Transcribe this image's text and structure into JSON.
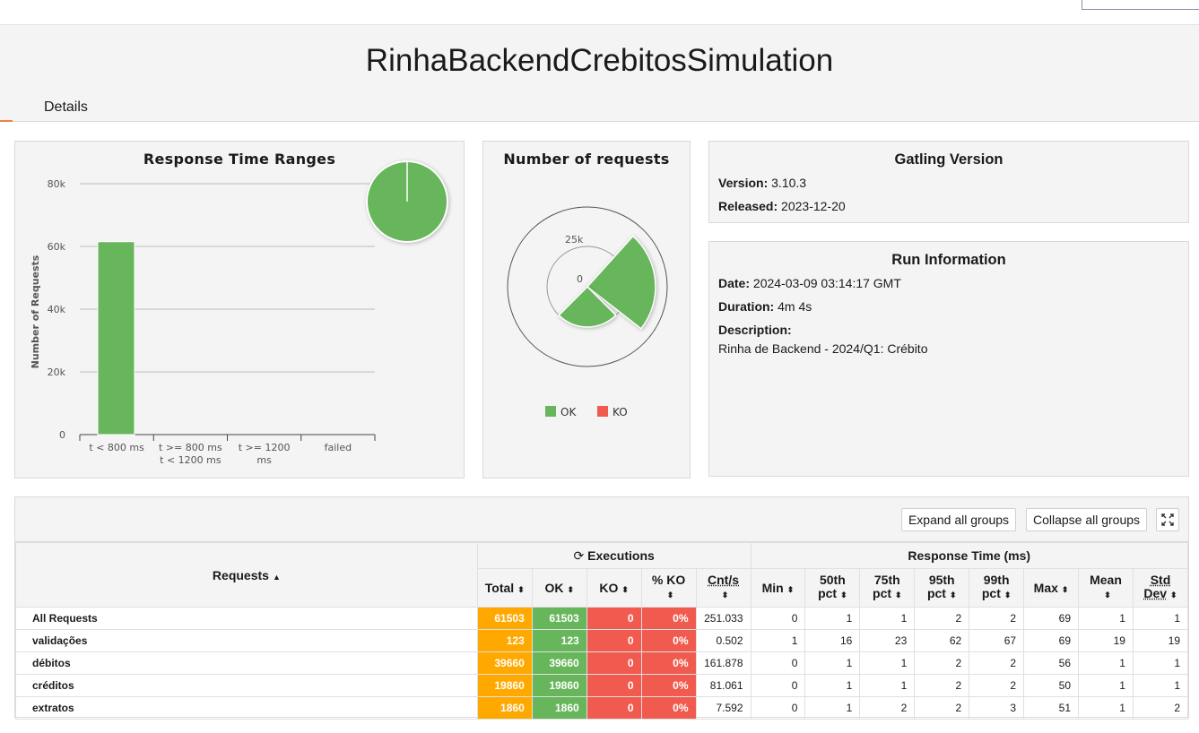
{
  "page": {
    "title": "RinhaBackendCrebitosSimulation",
    "tab_details": "Details"
  },
  "panels": {
    "response_time_ranges": {
      "title": "Response Time Ranges",
      "ylabel": "Number of Requests"
    },
    "number_of_requests": {
      "title": "Number of requests",
      "legend_ok": "OK",
      "legend_ko": "KO"
    },
    "gatling_version": {
      "title": "Gatling Version",
      "version_label": "Version:",
      "version_value": "3.10.3",
      "released_label": "Released:",
      "released_value": "2023-12-20"
    },
    "run_information": {
      "title": "Run Information",
      "date_label": "Date:",
      "date_value": "2024-03-09 03:14:17 GMT",
      "duration_label": "Duration:",
      "duration_value": "4m 4s",
      "description_label": "Description:",
      "description_value": "Rinha de Backend - 2024/Q1: Crébito"
    }
  },
  "colors": {
    "ok": "#68b65c",
    "ko": "#f15b4f",
    "total": "#ffa900",
    "accent": "#f0823c"
  },
  "chart_data": [
    {
      "type": "bar",
      "title": "Response Time Ranges",
      "ylabel": "Number of Requests",
      "categories": [
        "t < 800 ms",
        "t >= 800 ms\nt < 1200 ms",
        "t >= 1200\nms",
        "failed"
      ],
      "values": [
        61503,
        0,
        0,
        0
      ],
      "yticks": [
        "0",
        "20k",
        "40k",
        "60k",
        "80k"
      ],
      "ylim": [
        0,
        80000
      ],
      "grid": true,
      "inset_pie": {
        "ok": 61503,
        "ko": 0
      }
    },
    {
      "type": "pie",
      "title": "Number of requests",
      "variant": "polar",
      "radial_ticks": [
        "0",
        "25k"
      ],
      "series": [
        {
          "name": "OK",
          "values": [
            61503
          ]
        },
        {
          "name": "KO",
          "values": [
            0
          ]
        }
      ],
      "legend_placement": "bottom"
    }
  ],
  "stats": {
    "buttons": {
      "expand": "Expand all groups",
      "collapse": "Collapse all groups"
    },
    "headers": {
      "requests": "Requests",
      "executions": "Executions",
      "response_time": "Response Time (ms)",
      "total": "Total",
      "ok": "OK",
      "ko": "KO",
      "pct_ko": "% KO",
      "cnt_s": "Cnt/s",
      "min": "Min",
      "p50_a": "50th",
      "p50_b": "pct",
      "p75_a": "75th",
      "p75_b": "pct",
      "p95_a": "95th",
      "p95_b": "pct",
      "p99_a": "99th",
      "p99_b": "pct",
      "max": "Max",
      "mean": "Mean",
      "std_a": "Std",
      "std_b": "Dev"
    },
    "rows": [
      {
        "name": "All Requests",
        "total": "61503",
        "ok": "61503",
        "ko": "0",
        "pct_ko": "0%",
        "cnt_s": "251.033",
        "min": "0",
        "p50": "1",
        "p75": "1",
        "p95": "2",
        "p99": "2",
        "max": "69",
        "mean": "1",
        "std": "1"
      },
      {
        "name": "validações",
        "total": "123",
        "ok": "123",
        "ko": "0",
        "pct_ko": "0%",
        "cnt_s": "0.502",
        "min": "1",
        "p50": "16",
        "p75": "23",
        "p95": "62",
        "p99": "67",
        "max": "69",
        "mean": "19",
        "std": "19"
      },
      {
        "name": "débitos",
        "total": "39660",
        "ok": "39660",
        "ko": "0",
        "pct_ko": "0%",
        "cnt_s": "161.878",
        "min": "0",
        "p50": "1",
        "p75": "1",
        "p95": "2",
        "p99": "2",
        "max": "56",
        "mean": "1",
        "std": "1"
      },
      {
        "name": "créditos",
        "total": "19860",
        "ok": "19860",
        "ko": "0",
        "pct_ko": "0%",
        "cnt_s": "81.061",
        "min": "0",
        "p50": "1",
        "p75": "1",
        "p95": "2",
        "p99": "2",
        "max": "50",
        "mean": "1",
        "std": "1"
      },
      {
        "name": "extratos",
        "total": "1860",
        "ok": "1860",
        "ko": "0",
        "pct_ko": "0%",
        "cnt_s": "7.592",
        "min": "0",
        "p50": "1",
        "p75": "2",
        "p95": "2",
        "p99": "3",
        "max": "51",
        "mean": "1",
        "std": "2"
      }
    ]
  }
}
